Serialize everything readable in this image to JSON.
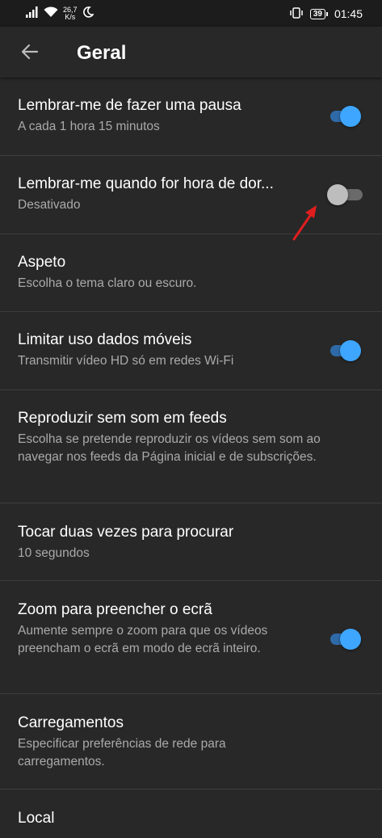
{
  "status_bar": {
    "speed_value": "26,7",
    "speed_unit": "K/s",
    "battery": "39",
    "time": "01:45",
    "icons": [
      "signal-icon",
      "wifi-icon",
      "moon-icon",
      "vibrate-icon",
      "battery-icon"
    ]
  },
  "header": {
    "title": "Geral",
    "back_icon": "arrow-left-icon"
  },
  "colors": {
    "background": "#282828",
    "status_bar": "#1c1c1c",
    "toggle_on": "#3ea6ff",
    "toggle_off": "#bdbdbd",
    "annotation_arrow": "#e01e1e"
  },
  "settings": [
    {
      "title": "Lembrar-me de fazer uma pausa",
      "subtitle": "A cada 1 hora 15 minutos",
      "toggle": "on"
    },
    {
      "title": "Lembrar-me quando for hora de dor...",
      "subtitle": "Desativado",
      "toggle": "off"
    },
    {
      "title": "Aspeto",
      "subtitle": "Escolha o tema claro ou escuro."
    },
    {
      "title": "Limitar uso dados móveis",
      "subtitle": "Transmitir vídeo HD só em redes Wi-Fi",
      "toggle": "on"
    },
    {
      "title": "Reproduzir sem som em feeds",
      "subtitle": "Escolha se pretende reproduzir os vídeos sem som ao navegar nos feeds da Página inicial e de subscrições."
    },
    {
      "title": "Tocar duas vezes para procurar",
      "subtitle": "10 segundos"
    },
    {
      "title": "Zoom para preencher o ecrã",
      "subtitle": "Aumente sempre o zoom para que os vídeos preencham o ecrã em modo de ecrã inteiro.",
      "toggle": "on"
    },
    {
      "title": "Carregamentos",
      "subtitle": "Especificar preferências de rede para carregamentos."
    },
    {
      "title": "Local"
    }
  ]
}
